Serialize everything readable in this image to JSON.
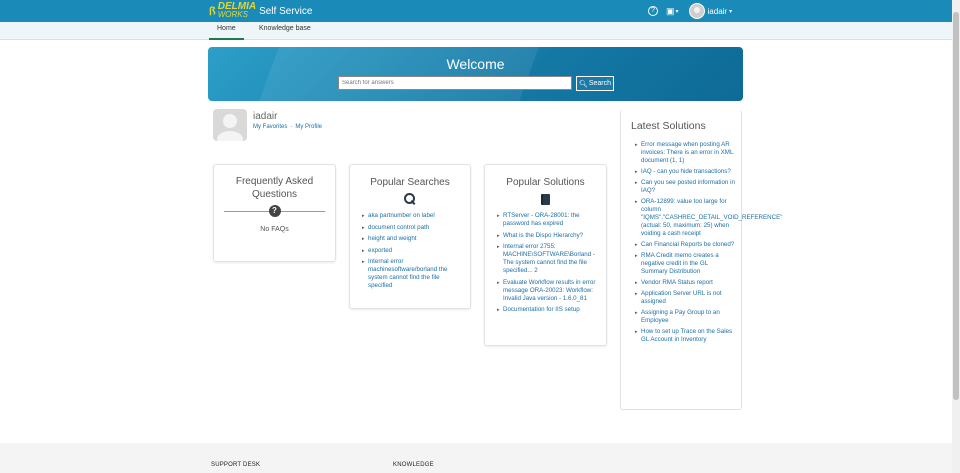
{
  "header": {
    "logo_mark": "ꟗ",
    "logo_top": "DELMIA",
    "logo_bottom": "WORKS",
    "app_name": "Self Service",
    "help_icon": "?",
    "user_name": "iadair"
  },
  "tabs": [
    {
      "label": "Home",
      "active": true
    },
    {
      "label": "Knowledge base",
      "active": false
    }
  ],
  "hero": {
    "title": "Welcome",
    "search_placeholder": "Search for answers",
    "search_button": "Search"
  },
  "profile": {
    "name": "iadair",
    "link_favorites": "My Favorites",
    "separator": "-",
    "link_profile": "My Profile"
  },
  "faq": {
    "title": "Frequently Asked Questions",
    "empty": "No FAQs"
  },
  "popular_searches": {
    "title": "Popular Searches",
    "items": [
      "aka partnumber on label",
      "document control path",
      "height and weight",
      "exported",
      "Internal error machinesoftware/borland the system cannot find the file specified"
    ]
  },
  "popular_solutions": {
    "title": "Popular Solutions",
    "items": [
      "RTServer - ORA-28001: the password has expired",
      "What is the Dispo Hierarchy?",
      "Internal error 2755: MACHINE\\SOFTWARE\\Borland - The system cannot find the file specified... 2",
      "Evaluate Workflow results in error message ORA-20023: Workflow: Invalid Java version - 1.6.0_81",
      "Documentation for IIS setup"
    ]
  },
  "latest_solutions": {
    "title": "Latest Solutions",
    "items": [
      "Error message when posting AR invoices: There is an error in XML document (1, 1)",
      "IAQ - can you hide transactions?",
      "Can you see posted information in IAQ?",
      "ORA-12899: value too large for column \"IQMS\".\"CASHREC_DETAIL_VOID_REFERENCE\" (actual: 50, maximum: 25) when voiding a cash receipt",
      "Can Financial Reports be cloned?",
      "RMA Credit memo creates a negative credit in the GL Summary Distribution",
      "Vendor RMA Status report",
      "Application Server URL is not assigned",
      "Assigning a Pay Group to an Employee",
      "How to set up Trace on the Sales GL Account in Inventory"
    ]
  },
  "footer": {
    "col1": "SUPPORT DESK",
    "col2": "KNOWLEDGE"
  },
  "colors": {
    "topbar": "#1a8ab8",
    "link": "#1d6fa5",
    "logo": "#e7d62a"
  }
}
